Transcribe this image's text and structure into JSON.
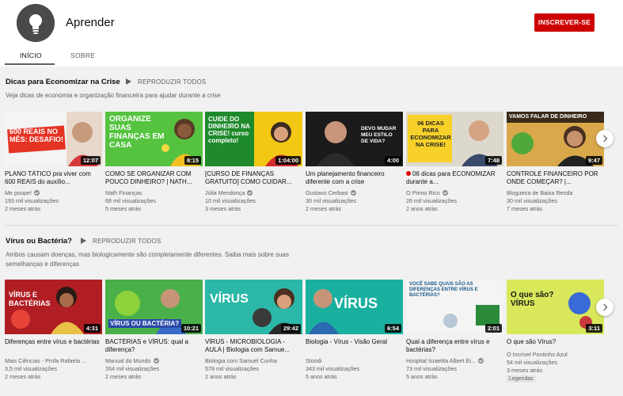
{
  "channel": {
    "name": "Aprender",
    "subscribe_label": "INSCREVER-SE",
    "tabs": [
      "INÍCIO",
      "SOBRE"
    ]
  },
  "shelves": [
    {
      "title": "Dicas para Economizar na Crise",
      "play_all": "REPRODUZIR TODOS",
      "description": "Veja dicas de economia e organização financeira para ajudar durante a crise",
      "videos": [
        {
          "title": "PLANO TÁTICO pra viver com 600 REAIS do auxílio...",
          "channel": "Me poupe!",
          "verified": true,
          "views": "193 mil visualizações",
          "age": "2 meses atrás",
          "duration": "12:07",
          "thumb_text": "600 REAIS NO MÊS: DESAFIO!"
        },
        {
          "title": "COMO SE ORGANIZAR COM POUCO DINHEIRO? | NATH...",
          "channel": "Nath Finanças",
          "verified": false,
          "views": "68 mil visualizações",
          "age": "5 meses atrás",
          "duration": "8:15",
          "thumb_text": "ORGANIZE SUAS FINANÇAS EM CASA"
        },
        {
          "title": "[CURSO DE FINANÇAS GRATUITO] COMO CUIDAR...",
          "channel": "Júlia Mendonça",
          "verified": true,
          "views": "10 mil visualizações",
          "age": "3 meses atrás",
          "duration": "1:04:00",
          "thumb_text": "CUIDE DO DINHEIRO NA CRISE! curso completo!"
        },
        {
          "title": "Um planejamento financeiro diferente com a crise",
          "channel": "Gustavo Cerbasi",
          "verified": true,
          "views": "30 mil visualizações",
          "age": "2 meses atrás",
          "duration": "4:00",
          "thumb_text": "DEVO MUDAR MEU ESTILO DE VIDA?"
        },
        {
          "title": "06 dicas para ECONOMIZAR durante a...",
          "channel": "O Primo Rico",
          "verified": true,
          "views": "26 mil visualizações",
          "age": "2 anos atrás",
          "duration": "7:48",
          "thumb_text": "06 DICAS PARA ECONOMIZAR NA CRISE!",
          "live_dot": true
        },
        {
          "title": "CONTROLE FINANCEIRO POR ONDE COMEÇAR? |...",
          "channel": "Blogueira de Baixa Renda",
          "verified": false,
          "views": "30 mil visualizações",
          "age": "7 meses atrás",
          "duration": "9:47",
          "thumb_text": "VAMOS FALAR DE DINHEIRO"
        }
      ]
    },
    {
      "title": "Vírus ou Bactéria?",
      "play_all": "REPRODUZIR TODOS",
      "description": "Ambos causam doenças, mas biologicamente são completamente diferentes. Saiba mais sobre suas semelhanças e diferenças",
      "videos": [
        {
          "title": "Diferenças entre vírus e bactérias",
          "channel": "Mais Ciências - Profa Rafaela ...",
          "verified": false,
          "views": "3,5 mil visualizações",
          "age": "2 meses atrás",
          "duration": "4:31",
          "thumb_text": "VÍRUS E BACTÉRIAS"
        },
        {
          "title": "BACTÉRIAS e VÍRUS: qual a diferença?",
          "channel": "Manual do Mundo",
          "verified": true,
          "views": "264 mil visualizações",
          "age": "2 meses atrás",
          "duration": "10:21",
          "thumb_text": "VÍRUS OU BACTÉRIA?"
        },
        {
          "title": "VÍRUS - MICROBIOLOGIA - AULA | Biologia com Samue...",
          "channel": "Biologia com Samuel Cunha",
          "verified": false,
          "views": "578 mil visualizações",
          "age": "2 anos atrás",
          "duration": "29:42",
          "thumb_text": "VÍRUS"
        },
        {
          "title": "Biologia - Vírus - Visão Geral",
          "channel": "Stoodi",
          "verified": false,
          "views": "343 mil visualizações",
          "age": "5 anos atrás",
          "duration": "6:54",
          "thumb_text": "VÍRUS"
        },
        {
          "title": "Qual a diferença entre vírus e bactérias?",
          "channel": "Hospital Israelita Albert Ei...",
          "verified": true,
          "views": "73 mil visualizações",
          "age": "5 anos atrás",
          "duration": "2:01",
          "thumb_text": "VOCÊ SABE QUAIS SÃO AS DIFERENÇAS ENTRE VÍRUS E BACTÉRIAS?"
        },
        {
          "title": "O que são Vírus?",
          "channel": "O Incrível Pontinho Azul",
          "verified": false,
          "views": "54 mil visualizações",
          "age": "3 meses atrás",
          "duration": "3:11",
          "thumb_text": "O que são? VÍRUS",
          "badge": "Legendas"
        }
      ]
    }
  ],
  "colors": {
    "subscribe": "#cc0000",
    "background": "#f1f1f1",
    "header": "#ffffff"
  },
  "icons": {
    "avatar": "lightbulb-icon",
    "play_all": "play-icon",
    "next": "chevron-right-icon",
    "verified": "verified-check-icon"
  }
}
